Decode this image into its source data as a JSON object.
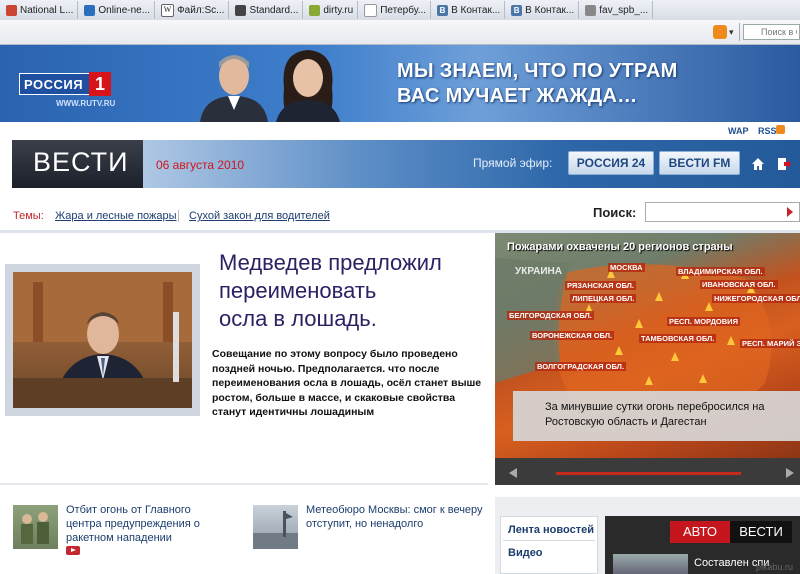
{
  "bookmarks": [
    {
      "label": "National L...",
      "color": "#c43"
    },
    {
      "label": "Online-ne...",
      "color": "#2a6fbd"
    },
    {
      "label": "Файл:Sc...",
      "color": "#333"
    },
    {
      "label": "Standard...",
      "color": "#444"
    },
    {
      "label": "dirty.ru",
      "color": "#8a3"
    },
    {
      "label": "Петербу...",
      "color": "#999"
    },
    {
      "label": "В Контак...",
      "color": "#4a76a8"
    },
    {
      "label": "В Контак...",
      "color": "#4a76a8"
    },
    {
      "label": "fav_spb_...",
      "color": "#888"
    }
  ],
  "browser": {
    "search_placeholder": "Поиск в G"
  },
  "banner": {
    "brand": "РОССИЯ",
    "brand_number": "1",
    "url": "WWW.RUTV.RU",
    "slogan_line1": "МЫ ЗНАЕМ, ЧТО ПО УТРАМ",
    "slogan_line2": "ВАС МУЧАЕТ ЖАЖДА…"
  },
  "top_links": {
    "wap": "WAP",
    "rss": "RSS"
  },
  "header": {
    "logo": "ВЕСТИ",
    "date": "06 августа 2010",
    "live_label": "Прямой эфир:",
    "channels": [
      "РОССИЯ 24",
      "ВЕСТИ FM"
    ]
  },
  "topics": {
    "label": "Темы:",
    "items": [
      "Жара и лесные пожары",
      "Сухой закон для водителей"
    ]
  },
  "search": {
    "label": "Поиск:",
    "value": ""
  },
  "main_story": {
    "headline_line1": "Медведев предложил",
    "headline_line2": "переименовать",
    "headline_line3": "осла в лошадь.",
    "lead": "Совещание по этому вопросу было проведено поздней ночью. Предполагается. что после переименования осла в лошадь, осёл станет выше ростом, больше в массе, и скаковые свойства станут идентичны лошадиным"
  },
  "fire_panel": {
    "title": "Пожарами охвачены 20 регионов страны",
    "country_label": "УКРАИНА",
    "regions": [
      "МОСКВА",
      "ВЛАДИМИРСКАЯ ОБЛ.",
      "РЯЗАНСКАЯ ОБЛ.",
      "ИВАНОВСКАЯ ОБЛ.",
      "ЛИПЕЦКАЯ ОБЛ.",
      "НИЖЕГОРОДСКАЯ ОБЛ.",
      "БЕЛГОРОДСКАЯ ОБЛ.",
      "РЕСП. МОРДОВИЯ",
      "ВОРОНЕЖСКАЯ ОБЛ.",
      "ТАМБОВСКАЯ ОБЛ.",
      "РЕСП. МАРИЙ Э",
      "ВОЛГОГРАДСКАЯ ОБЛ."
    ],
    "caption": "За минувшие сутки огонь перебросился на Ростовскую область и Дагестан"
  },
  "stories": [
    {
      "text": "Отбит огонь от Главного центра предупреждения о ракетном нападении"
    },
    {
      "text": "Метеобюро Москвы: смог к вечеру отступит, но ненадолго"
    }
  ],
  "side_tabs": [
    "Лента новостей",
    "Видео"
  ],
  "auto_block": {
    "left": "АВТО",
    "right": "ВЕСТИ",
    "teaser": "Составлен спи"
  },
  "watermark": "pikabu.ru"
}
